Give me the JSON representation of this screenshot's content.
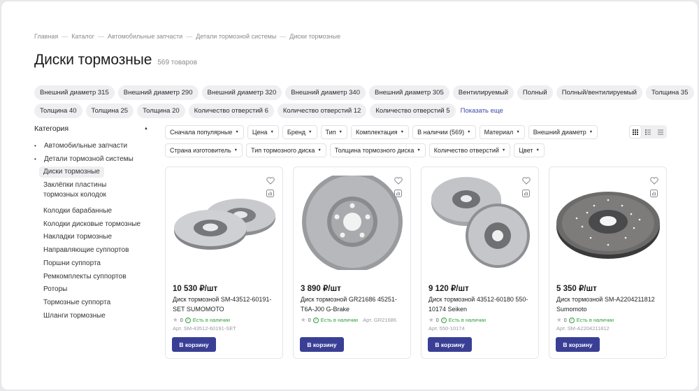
{
  "breadcrumb": [
    "Главная",
    "Каталог",
    "Автомобильные запчасти",
    "Детали тормозной системы",
    "Диски тормозные"
  ],
  "breadcrumb_sep": "—",
  "title": "Диски тормозные",
  "count": "569 товаров",
  "tags_row1": [
    "Внешний диаметр 315",
    "Внешний диаметр 290",
    "Внешний диаметр 320",
    "Внешний диаметр 340",
    "Внешний диаметр 305",
    "Вентилируемый",
    "Полный",
    "Полный/вентилируемый",
    "Толщина 35"
  ],
  "tags_row2": [
    "Толщина 40",
    "Толщина 25",
    "Толщина 20",
    "Количество отверстий 6",
    "Количество отверстий 12",
    "Количество отверстий 5"
  ],
  "show_more": "Показать еще",
  "sidebar": {
    "heading": "Категория",
    "items": [
      {
        "label": "Автомобильные запчасти"
      },
      {
        "label": "Детали тормозной системы"
      }
    ],
    "sub_items": [
      {
        "label": "Диски тормозные"
      },
      {
        "label": "Заклёпки пластины тормозных колодок"
      },
      {
        "label": "Колодки барабанные"
      },
      {
        "label": "Колодки дисковые тормозные"
      },
      {
        "label": "Накладки тормозные"
      },
      {
        "label": "Направляющие суппортов"
      },
      {
        "label": "Поршни суппорта"
      },
      {
        "label": "Ремкомплекты суппортов"
      },
      {
        "label": "Роторы"
      },
      {
        "label": "Тормозные суппорта"
      },
      {
        "label": "Шланги тормозные"
      }
    ]
  },
  "filters_row1": [
    "Сначала популярные",
    "Цена",
    "Бренд",
    "Тип",
    "Комплектация",
    "В наличии (569)",
    "Материал",
    "Внешний диаметр"
  ],
  "filters_row2": [
    "Страна изготовитель",
    "Тип тормозного диска",
    "Толщина тормозного диска",
    "Количество отверстий",
    "Цвет"
  ],
  "products": [
    {
      "price": "10 530 ₽/шт",
      "name": "Диск тормозной SM-43512-60191-SET SUMOMOTO",
      "rating": "0",
      "availability": "Есть в наличии",
      "sku": "Арт. SM-43512-60191-SET"
    },
    {
      "price": "3 890 ₽/шт",
      "name": "Диск тормозной GR21686 45251-T6A-J00 G-Brake",
      "rating": "0",
      "availability": "Есть в наличии",
      "sku": "Арт. GR21686"
    },
    {
      "price": "9 120 ₽/шт",
      "name": "Диск тормозной 43512-60180 550-10174 Seiken",
      "rating": "0",
      "availability": "Есть в наличии",
      "sku": "Арт. 550-10174"
    },
    {
      "price": "5 350 ₽/шт",
      "name": "Диск тормозной SM-A2204211812 Sumomoto",
      "rating": "0",
      "availability": "Есть в наличии",
      "sku": "Арт. SM-A2204211812"
    }
  ],
  "cart_label": "В корзину",
  "colors": {
    "accent": "#3a3f96",
    "in_stock": "#2f9e3c",
    "chip_bg": "#efeff2"
  }
}
